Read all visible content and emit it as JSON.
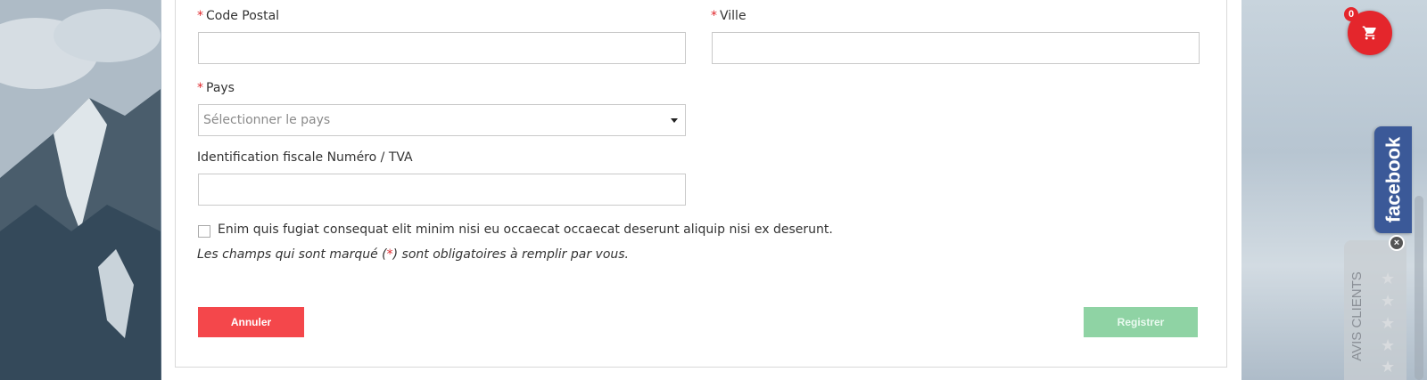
{
  "form": {
    "postal_code_label": "Code Postal",
    "city_label": "Ville",
    "country_label": "Pays",
    "country_placeholder": "Sélectionner le pays",
    "vat_label": "Identification fiscale Numéro / TVA",
    "consent_text": "Enim quis fugiat consequat elit minim nisi eu occaecat occaecat deserunt aliquip nisi ex deserunt.",
    "required_marker": "*",
    "note_before": "Les champs qui sont marqué (",
    "note_after": ") sont obligatoires à remplir par vous.",
    "cancel_label": "Annuler",
    "register_label": "Registrer",
    "postal_code_value": "",
    "city_value": "",
    "vat_value": ""
  },
  "cart": {
    "count": "0",
    "icon": "cart-icon"
  },
  "social": {
    "facebook_label": "facebook"
  },
  "reviews": {
    "label": "AVIS CLIENTS",
    "stars": 5,
    "close_label": "×"
  },
  "colors": {
    "required": "#e0262b",
    "cancel": "#f4474b",
    "register": "#8fd3a4",
    "cart": "#e4262c",
    "facebook": "#3b5998"
  }
}
